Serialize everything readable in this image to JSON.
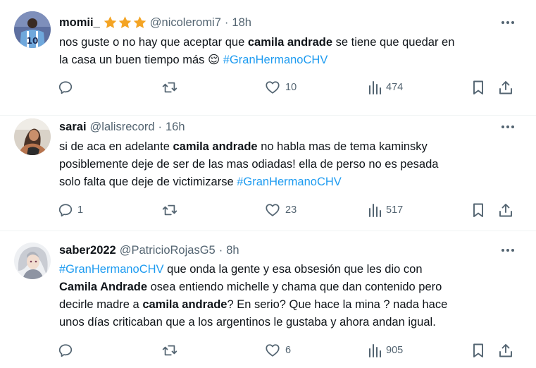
{
  "tweets": [
    {
      "name": "momii_",
      "stars": [
        "star-icon",
        "star-icon",
        "star-icon"
      ],
      "handle": "@nicoleromi7",
      "sep": "·",
      "time": "18h",
      "lines": [
        {
          "parts": [
            {
              "t": "nos guste o no hay que aceptar que "
            },
            {
              "t": "camila andrade",
              "b": 1
            },
            {
              "t": " se tiene que quedar en"
            }
          ]
        },
        {
          "parts": [
            {
              "t": "la casa un buen tiempo más "
            },
            {
              "t": "😌",
              "emoji": 1
            },
            {
              "t": " "
            },
            {
              "t": "#GranHermanoCHV",
              "tag": 1
            }
          ]
        }
      ],
      "replies": "",
      "likes": "10",
      "views": "474"
    },
    {
      "name": "sarai",
      "handle": "@lalisrecord",
      "sep": "·",
      "time": "16h",
      "lines": [
        {
          "parts": [
            {
              "t": "si de aca en adelante "
            },
            {
              "t": "camila andrade",
              "b": 1
            },
            {
              "t": " no habla mas de tema kaminsky"
            }
          ]
        },
        {
          "parts": [
            {
              "t": "posiblemente deje de ser de las mas odiadas! ella de perso no es pesada"
            }
          ]
        },
        {
          "parts": [
            {
              "t": "solo falta que deje de victimizarse "
            },
            {
              "t": "#GranHermanoCHV",
              "tag": 1
            }
          ]
        }
      ],
      "replies": "1",
      "likes": "23",
      "views": "517"
    },
    {
      "name": "saber2022",
      "handle": "@PatricioRojasG5",
      "sep": "·",
      "time": "8h",
      "lines": [
        {
          "parts": [
            {
              "t": "#GranHermanoCHV",
              "tag": 1
            },
            {
              "t": " que onda la gente y esa obsesión que les dio con"
            }
          ]
        },
        {
          "parts": [
            {
              "t": "Camila Andrade",
              "b": 1
            },
            {
              "t": " osea entiendo michelle y chama que dan contenido pero"
            }
          ]
        },
        {
          "parts": [
            {
              "t": "decirle madre a "
            },
            {
              "t": "camila andrade",
              "b": 1
            },
            {
              "t": "? En serio? Que hace la mina ? nada hace"
            }
          ]
        },
        {
          "parts": [
            {
              "t": "unos días criticaban que a los argentinos le gustaba y ahora andan igual."
            }
          ]
        }
      ],
      "replies": "",
      "likes": "6",
      "views": "905"
    }
  ],
  "icons": {
    "reply": "reply-icon",
    "retweet": "retweet-icon",
    "like": "heart-icon",
    "views": "views-icon",
    "bookmark": "bookmark-icon",
    "share": "share-icon",
    "more": "more-icon"
  },
  "colors": {
    "text": "#0f1419",
    "muted": "#536471",
    "link": "#1d9bf0",
    "star": "#f4a424",
    "divider": "#eff3f4"
  }
}
